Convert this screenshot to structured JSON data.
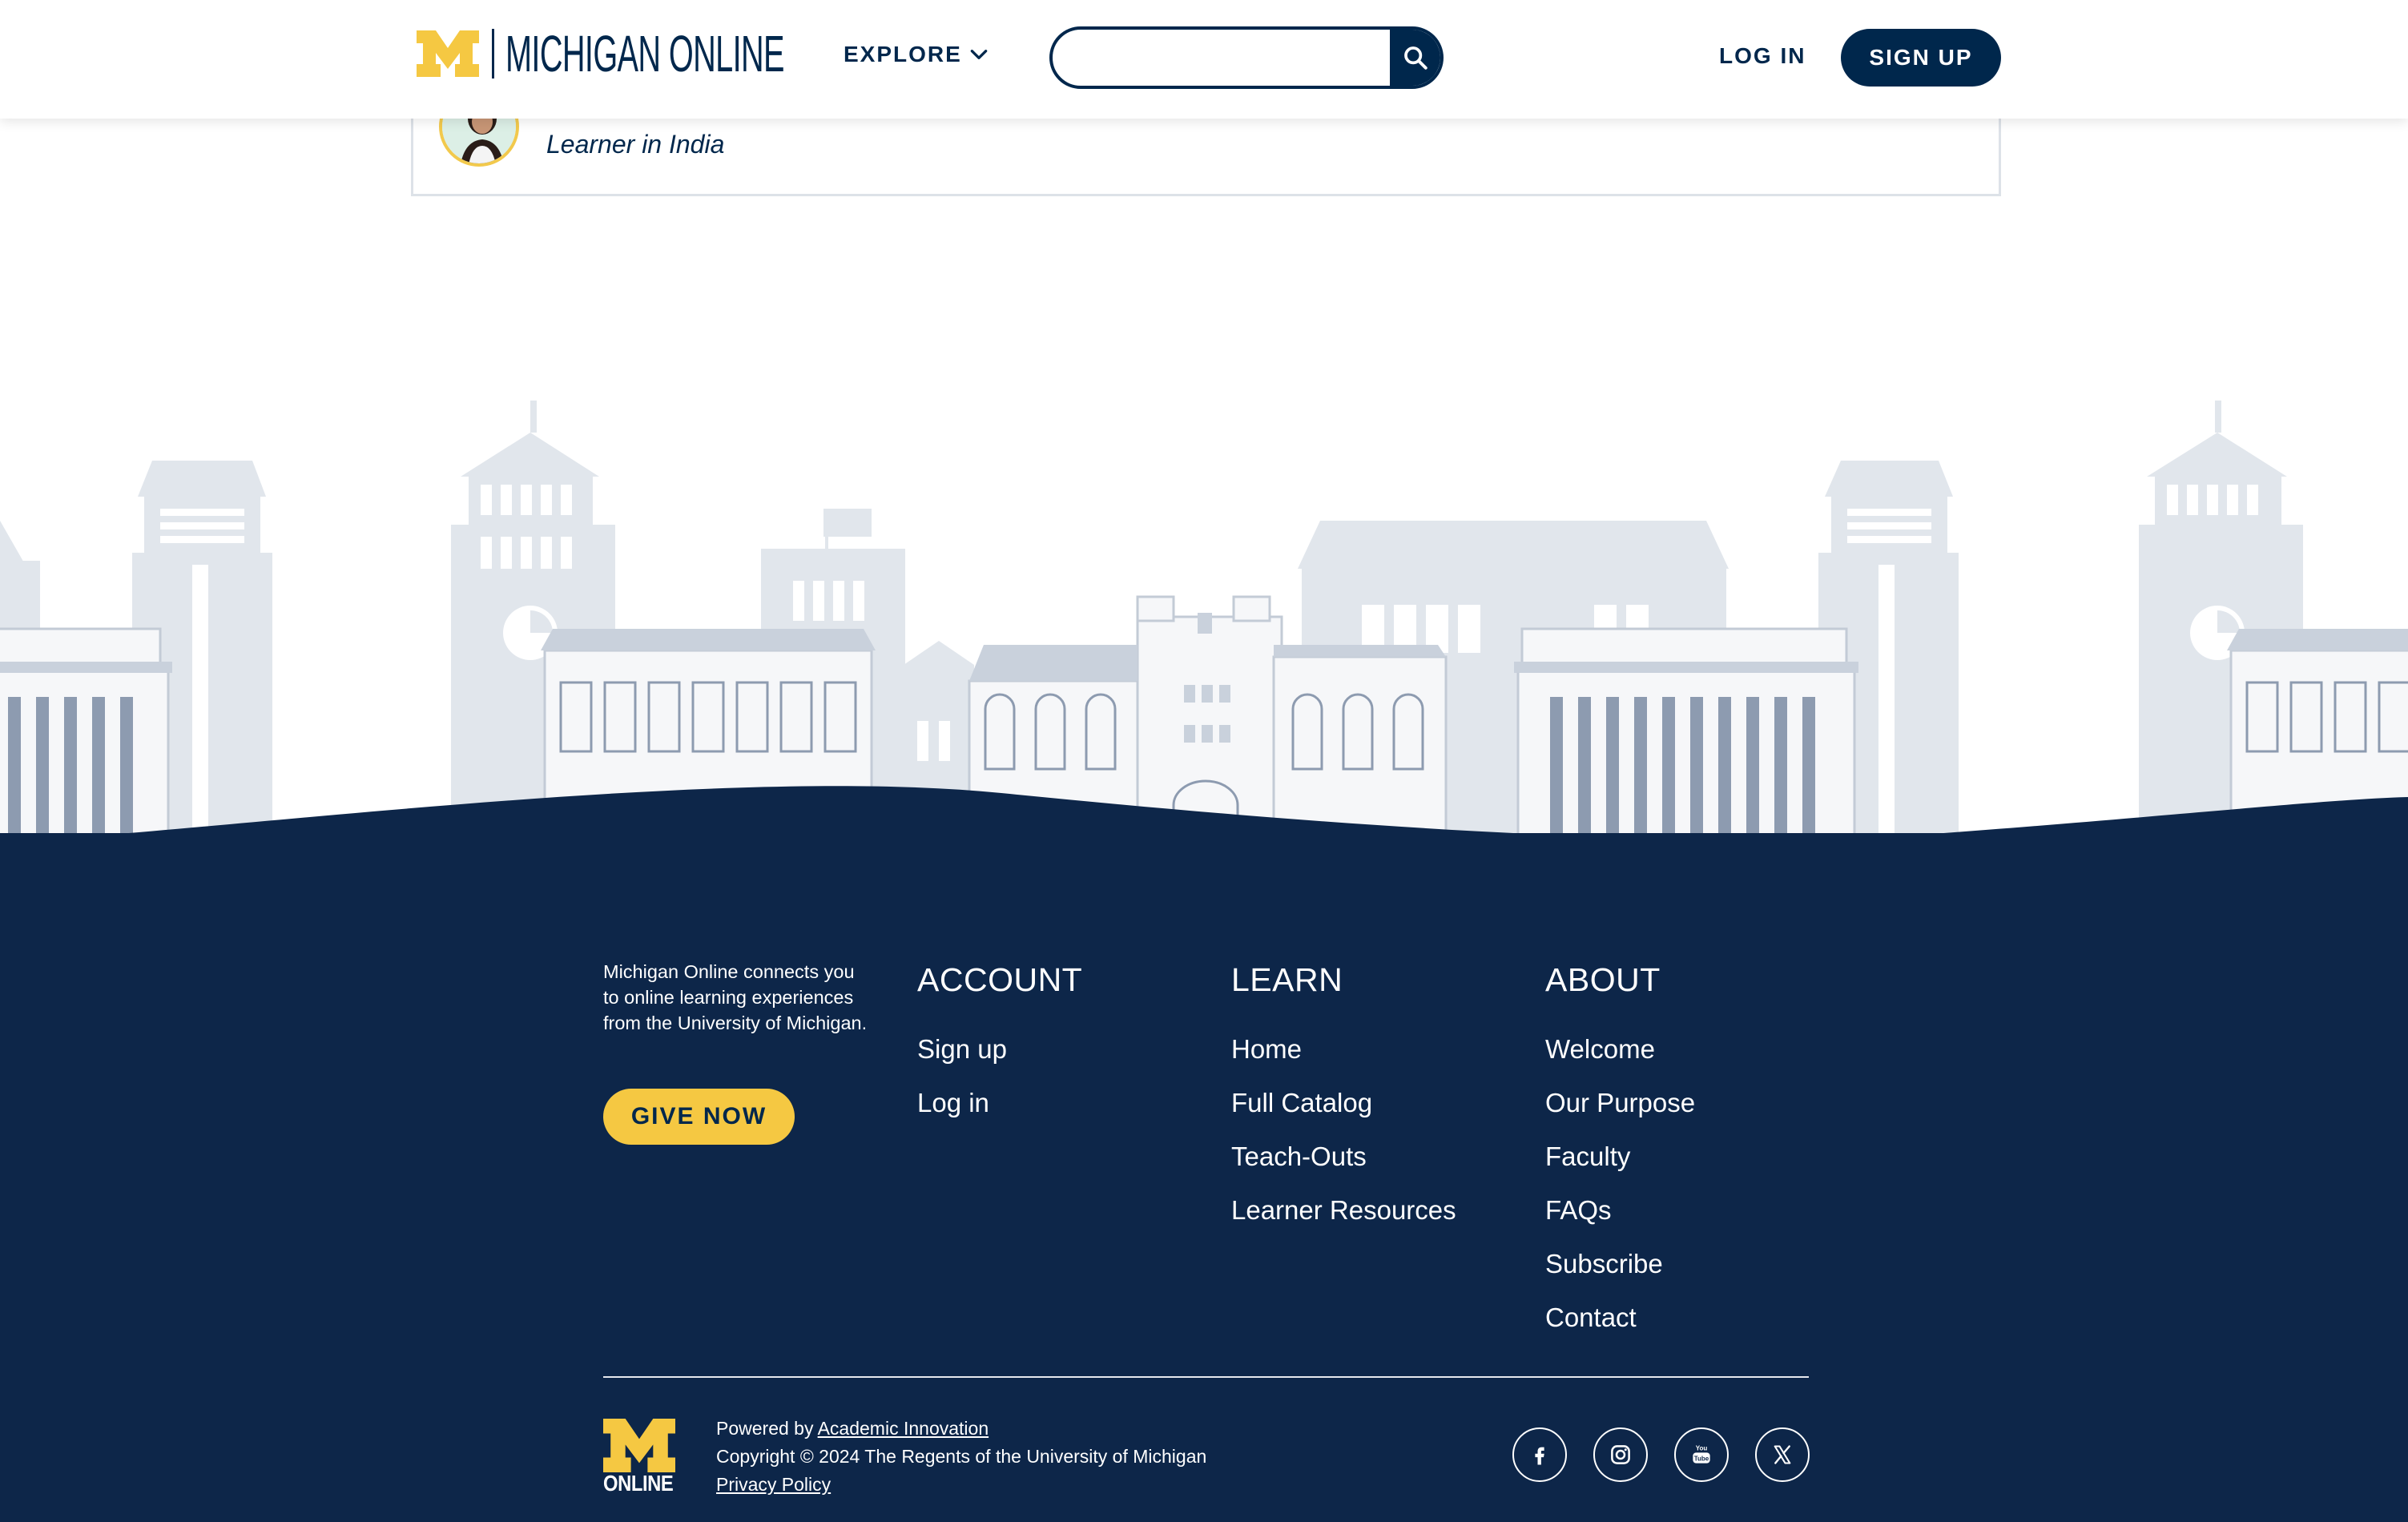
{
  "header": {
    "brand": "MICHIGAN ONLINE",
    "explore_label": "EXPLORE",
    "search_placeholder": "",
    "login_label": "LOG IN",
    "signup_label": "SIGN UP"
  },
  "testimonial": {
    "learner_location": "Learner in India"
  },
  "footer": {
    "about_text": "Michigan Online connects you to online learning experiences from the University of Michigan.",
    "give_label": "GIVE NOW",
    "columns": [
      {
        "title": "ACCOUNT",
        "links": [
          "Sign up",
          "Log in"
        ]
      },
      {
        "title": "LEARN",
        "links": [
          "Home",
          "Full Catalog",
          "Teach-Outs",
          "Learner Resources"
        ]
      },
      {
        "title": "ABOUT",
        "links": [
          "Welcome",
          "Our Purpose",
          "Faculty",
          "FAQs",
          "Subscribe",
          "Contact"
        ]
      }
    ],
    "logo_word": "ONLINE",
    "powered_by_prefix": "Powered by ",
    "powered_by_link": "Academic Innovation",
    "copyright": "Copyright © 2024 The Regents of the University of Michigan",
    "privacy_label": "Privacy Policy",
    "socials": [
      "facebook-icon",
      "instagram-icon",
      "youtube-icon",
      "x-twitter-icon"
    ]
  },
  "colors": {
    "navy": "#00274c",
    "footer_bg": "#0d2649",
    "maize": "#f5c842",
    "skyline_light": "#e1e6ec",
    "skyline_mid": "#c9d1dc",
    "skyline_dark": "#8d9bb0"
  }
}
